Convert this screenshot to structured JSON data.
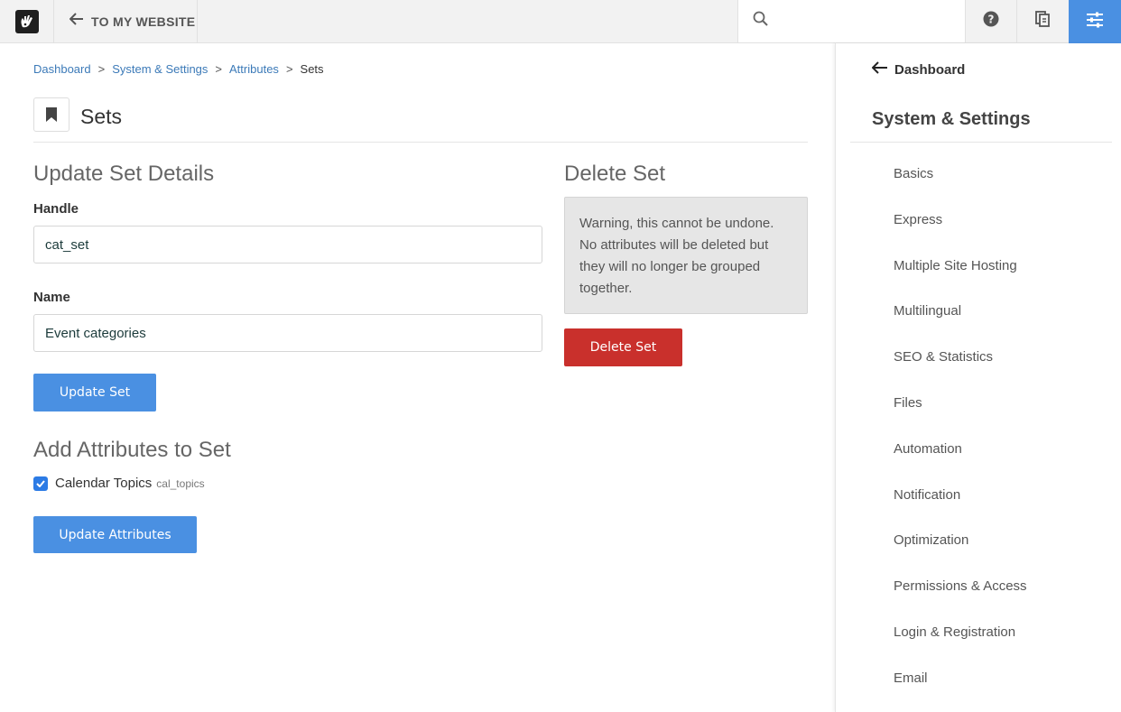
{
  "topbar": {
    "back_label": "TO MY WEBSITE",
    "search_placeholder": "",
    "accent_color": "#4a90e2"
  },
  "breadcrumb": {
    "items": [
      "Dashboard",
      "System & Settings",
      "Attributes"
    ],
    "separator": ">",
    "current": "Sets"
  },
  "page": {
    "title": "Sets",
    "icon": "bookmark-icon"
  },
  "update_section": {
    "title": "Update Set Details",
    "handle_label": "Handle",
    "handle_value": "cat_set",
    "name_label": "Name",
    "name_value": "Event categories",
    "button_label": "Update Set"
  },
  "delete_section": {
    "title": "Delete Set",
    "warning": "Warning, this cannot be undone. No attributes will be deleted but they will no longer be grouped together.",
    "button_label": "Delete Set",
    "danger_color": "#c9302c"
  },
  "attributes_section": {
    "title": "Add Attributes to Set",
    "attribute_name": "Calendar Topics",
    "attribute_handle": "cal_topics",
    "checked": true,
    "button_label": "Update Attributes"
  },
  "panel": {
    "back_label": "Dashboard",
    "title": "System & Settings",
    "items": [
      "Basics",
      "Express",
      "Multiple Site Hosting",
      "Multilingual",
      "SEO & Statistics",
      "Files",
      "Automation",
      "Notification",
      "Optimization",
      "Permissions & Access",
      "Login & Registration",
      "Email"
    ]
  }
}
